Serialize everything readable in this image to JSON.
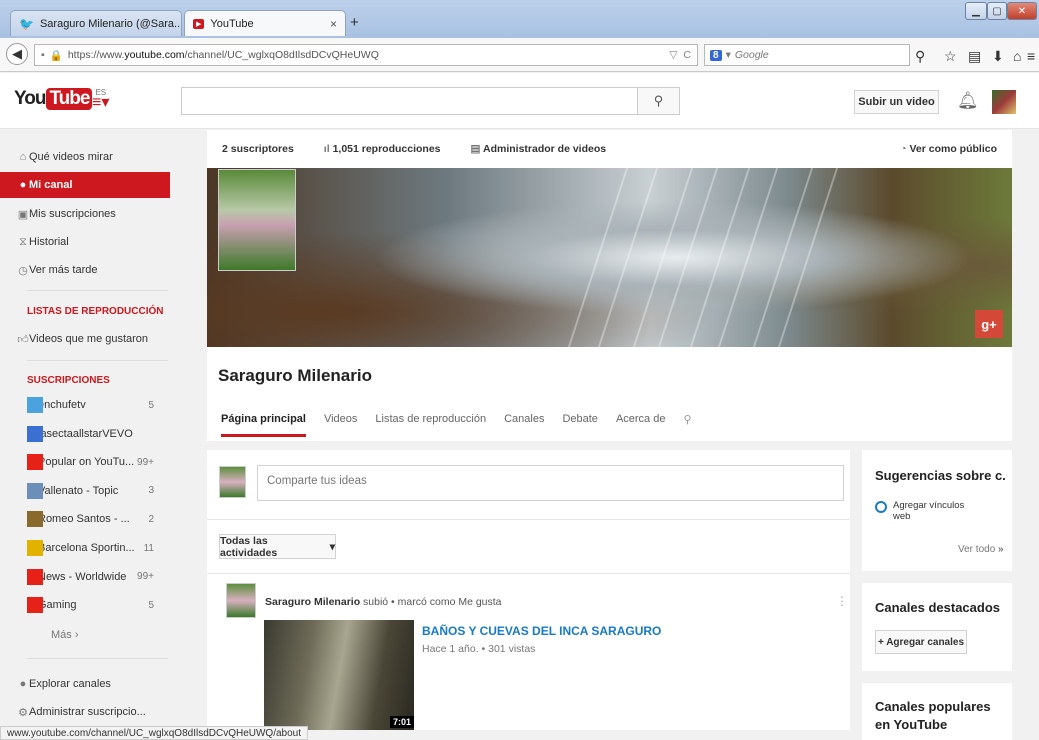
{
  "browser": {
    "tabs": [
      {
        "label": "Saraguro Milenario (@Sara...",
        "close": "×"
      },
      {
        "label": "YouTube",
        "close": "×"
      }
    ],
    "new_tab": "+",
    "url_prefix": "https://www.",
    "url_domain": "youtube.com",
    "url_path": "/channel/UC_wglxqO8dIlsdDCvQHeUWQ",
    "search_engine": "Google",
    "search_badge": "8",
    "status_url": "www.youtube.com/channel/UC_wglxqO8dIlsdDCvQHeUWQ/about"
  },
  "yt": {
    "logo_you": "You",
    "logo_tube": "Tube",
    "logo_region": "ES",
    "upload_label": "Subir un video"
  },
  "sidebar": {
    "main_items": [
      {
        "label": "Qué videos mirar",
        "icon": "home-icon"
      },
      {
        "label": "Mi canal",
        "icon": "account-icon"
      },
      {
        "label": "Mis suscripciones",
        "icon": "subscriptions-icon"
      },
      {
        "label": "Historial",
        "icon": "history-icon"
      },
      {
        "label": "Ver más tarde",
        "icon": "watch-later-icon"
      }
    ],
    "playlists_heading": "LISTAS DE REPRODUCCIÓN",
    "liked_label": "Videos que me gustaron",
    "subs_heading": "SUSCRIPCIONES",
    "subscriptions": [
      {
        "name": "enchufetv",
        "count": "5",
        "color": "#4aa3df"
      },
      {
        "name": "lasectaallstarVEVO",
        "count": "",
        "color": "#3b6fd1"
      },
      {
        "name": "Popular on YouTu...",
        "count": "99+",
        "color": "#e62117"
      },
      {
        "name": "Vallenato - Topic",
        "count": "3",
        "color": "#6b8fb8"
      },
      {
        "name": "Romeo Santos - ...",
        "count": "2",
        "color": "#8a6a2a"
      },
      {
        "name": "Barcelona Sportin...",
        "count": "11",
        "color": "#e2b200"
      },
      {
        "name": "News - Worldwide",
        "count": "99+",
        "color": "#e62117"
      },
      {
        "name": "Gaming",
        "count": "5",
        "color": "#e62117"
      }
    ],
    "more_label": "Más ›",
    "explore_label": "Explorar canales",
    "manage_label": "Administrar suscripcio..."
  },
  "channel": {
    "subscribers": "2 suscriptores",
    "views": "1,051 reproducciones",
    "video_manager": "Administrador de videos",
    "view_as_public": "Ver como público",
    "name": "Saraguro Milenario",
    "tabs": [
      "Página principal",
      "Videos",
      "Listas de reproducción",
      "Canales",
      "Debate",
      "Acerca de"
    ]
  },
  "feed": {
    "share_placeholder": "Comparte tus ideas",
    "filter_label": "Todas las actividades",
    "activity_user": "Saraguro Milenario",
    "activity_text": " subió • marcó como Me gusta",
    "video_title": "BAÑOS Y CUEVAS DEL INCA SARAGURO",
    "video_meta": "Hace 1 año. • 301 vistas",
    "video_duration": "7:01"
  },
  "right": {
    "suggestions_title": "Sugerencias sobre c...",
    "suggestion_link": "Agregar vínculos web",
    "see_all": "Ver todo",
    "featured_title": "Canales destacados",
    "add_channels": "+ Agregar canales",
    "popular_title": "Canales populares en YouTube"
  },
  "colors": {
    "accent": "#cc181e",
    "link": "#167ac6"
  }
}
